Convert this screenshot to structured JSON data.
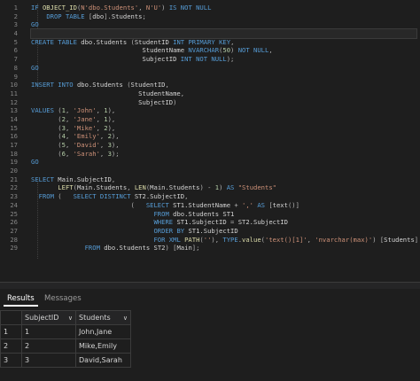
{
  "editor": {
    "line_numbers": [
      "1",
      "2",
      "3",
      "4",
      "5",
      "6",
      "7",
      "8",
      "9",
      "10",
      "11",
      "12",
      "13",
      "14",
      "15",
      "16",
      "17",
      "18",
      "19",
      "20",
      "21",
      "22",
      "23",
      "24",
      "25",
      "26",
      "27",
      "28",
      "29"
    ],
    "lines": [
      [
        [
          "kw",
          "IF "
        ],
        [
          "fn",
          "OBJECT_ID"
        ],
        [
          "op",
          "("
        ],
        [
          "str",
          "N'dbo.Students'"
        ],
        [
          "op",
          ", "
        ],
        [
          "str",
          "N'U'"
        ],
        [
          "op",
          ") "
        ],
        [
          "kw",
          "IS NOT NULL"
        ]
      ],
      [
        [
          "id",
          "    "
        ],
        [
          "kw",
          "DROP TABLE "
        ],
        [
          "op",
          "["
        ],
        [
          "id",
          "dbo"
        ],
        [
          "op",
          "]."
        ],
        [
          "id",
          "Students"
        ],
        [
          "op",
          ";"
        ]
      ],
      [
        [
          "kw",
          "GO"
        ]
      ],
      [],
      [
        [
          "kw",
          "CREATE TABLE "
        ],
        [
          "id",
          "dbo.Students "
        ],
        [
          "op",
          "("
        ],
        [
          "id",
          "StudentID "
        ],
        [
          "kw",
          "INT PRIMARY KEY"
        ],
        [
          "op",
          ","
        ]
      ],
      [
        [
          "id",
          "                             StudentName "
        ],
        [
          "kw",
          "NVARCHAR"
        ],
        [
          "op",
          "("
        ],
        [
          "num",
          "50"
        ],
        [
          "op",
          ") "
        ],
        [
          "kw",
          "NOT NULL"
        ],
        [
          "op",
          ","
        ]
      ],
      [
        [
          "id",
          "                             SubjectID "
        ],
        [
          "kw",
          "INT NOT NULL"
        ],
        [
          "op",
          ");"
        ]
      ],
      [
        [
          "kw",
          "GO"
        ]
      ],
      [],
      [
        [
          "kw",
          "INSERT INTO "
        ],
        [
          "id",
          "dbo.Students "
        ],
        [
          "op",
          "("
        ],
        [
          "id",
          "StudentID"
        ],
        [
          "op",
          ","
        ]
      ],
      [
        [
          "id",
          "                            StudentName"
        ],
        [
          "op",
          ","
        ]
      ],
      [
        [
          "id",
          "                            SubjectID"
        ],
        [
          "op",
          ")"
        ]
      ],
      [
        [
          "kw",
          "VALUES "
        ],
        [
          "op",
          "("
        ],
        [
          "num",
          "1"
        ],
        [
          "op",
          ", "
        ],
        [
          "str",
          "'John'"
        ],
        [
          "op",
          ", "
        ],
        [
          "num",
          "1"
        ],
        [
          "op",
          "),"
        ]
      ],
      [
        [
          "id",
          "       "
        ],
        [
          "op",
          "("
        ],
        [
          "num",
          "2"
        ],
        [
          "op",
          ", "
        ],
        [
          "str",
          "'Jane'"
        ],
        [
          "op",
          ", "
        ],
        [
          "num",
          "1"
        ],
        [
          "op",
          "),"
        ]
      ],
      [
        [
          "id",
          "       "
        ],
        [
          "op",
          "("
        ],
        [
          "num",
          "3"
        ],
        [
          "op",
          ", "
        ],
        [
          "str",
          "'Mike'"
        ],
        [
          "op",
          ", "
        ],
        [
          "num",
          "2"
        ],
        [
          "op",
          "),"
        ]
      ],
      [
        [
          "id",
          "       "
        ],
        [
          "op",
          "("
        ],
        [
          "num",
          "4"
        ],
        [
          "op",
          ", "
        ],
        [
          "str",
          "'Emily'"
        ],
        [
          "op",
          ", "
        ],
        [
          "num",
          "2"
        ],
        [
          "op",
          "),"
        ]
      ],
      [
        [
          "id",
          "       "
        ],
        [
          "op",
          "("
        ],
        [
          "num",
          "5"
        ],
        [
          "op",
          ", "
        ],
        [
          "str",
          "'David'"
        ],
        [
          "op",
          ", "
        ],
        [
          "num",
          "3"
        ],
        [
          "op",
          "),"
        ]
      ],
      [
        [
          "id",
          "       "
        ],
        [
          "op",
          "("
        ],
        [
          "num",
          "6"
        ],
        [
          "op",
          ", "
        ],
        [
          "str",
          "'Sarah'"
        ],
        [
          "op",
          ", "
        ],
        [
          "num",
          "3"
        ],
        [
          "op",
          ");"
        ]
      ],
      [
        [
          "kw",
          "GO"
        ]
      ],
      [],
      [
        [
          "kw",
          "SELECT "
        ],
        [
          "id",
          "Main.SubjectID"
        ],
        [
          "op",
          ","
        ]
      ],
      [
        [
          "id",
          "       "
        ],
        [
          "fn",
          "LEFT"
        ],
        [
          "op",
          "("
        ],
        [
          "id",
          "Main.Students"
        ],
        [
          "op",
          ", "
        ],
        [
          "fn",
          "LEN"
        ],
        [
          "op",
          "("
        ],
        [
          "id",
          "Main.Students"
        ],
        [
          "op",
          ") - "
        ],
        [
          "num",
          "1"
        ],
        [
          "op",
          ") "
        ],
        [
          "kw",
          "AS "
        ],
        [
          "str",
          "\"Students\""
        ]
      ],
      [
        [
          "id",
          "  "
        ],
        [
          "kw",
          "FROM "
        ],
        [
          "op",
          "(   "
        ],
        [
          "kw",
          "SELECT DISTINCT "
        ],
        [
          "id",
          "ST2.SubjectID"
        ],
        [
          "op",
          ","
        ]
      ],
      [
        [
          "id",
          "                          "
        ],
        [
          "op",
          "(   "
        ],
        [
          "kw",
          "SELECT "
        ],
        [
          "id",
          "ST1.StudentName "
        ],
        [
          "op",
          "+ "
        ],
        [
          "str",
          "','"
        ],
        [
          "id",
          " "
        ],
        [
          "kw",
          "AS "
        ],
        [
          "op",
          "["
        ],
        [
          "id",
          "text"
        ],
        [
          "op",
          "()]"
        ]
      ],
      [
        [
          "id",
          "                                "
        ],
        [
          "kw",
          "FROM "
        ],
        [
          "id",
          "dbo.Students ST1"
        ]
      ],
      [
        [
          "id",
          "                                "
        ],
        [
          "kw",
          "WHERE "
        ],
        [
          "id",
          "ST1.SubjectID "
        ],
        [
          "op",
          "= "
        ],
        [
          "id",
          "ST2.SubjectID"
        ]
      ],
      [
        [
          "id",
          "                                "
        ],
        [
          "kw",
          "ORDER BY "
        ],
        [
          "id",
          "ST1.SubjectID"
        ]
      ],
      [
        [
          "id",
          "                                "
        ],
        [
          "kw",
          "FOR XML "
        ],
        [
          "fn",
          "PATH"
        ],
        [
          "op",
          "("
        ],
        [
          "str",
          "''"
        ],
        [
          "op",
          "), "
        ],
        [
          "kw",
          "TYPE"
        ],
        [
          "op",
          "."
        ],
        [
          "fn",
          "value"
        ],
        [
          "op",
          "("
        ],
        [
          "str",
          "'text()[1]'"
        ],
        [
          "op",
          ", "
        ],
        [
          "str",
          "'nvarchar(max)'"
        ],
        [
          "op",
          ") ["
        ],
        [
          "id",
          "Students"
        ],
        [
          "op",
          "]"
        ]
      ],
      [
        [
          "id",
          "              "
        ],
        [
          "kw",
          "FROM "
        ],
        [
          "id",
          "dbo.Students ST2"
        ],
        [
          "op",
          ") ["
        ],
        [
          "id",
          "Main"
        ],
        [
          "op",
          "];"
        ]
      ]
    ]
  },
  "results_pane": {
    "tabs": [
      {
        "label": "Results"
      },
      {
        "label": "Messages"
      }
    ],
    "columns": [
      "SubjectID",
      "Students"
    ],
    "rows": [
      {
        "num": "1",
        "subject_id": "1",
        "students": "John,Jane"
      },
      {
        "num": "2",
        "subject_id": "2",
        "students": "Mike,Emily"
      },
      {
        "num": "3",
        "subject_id": "3",
        "students": "David,Sarah"
      }
    ]
  },
  "colors": {
    "keyword": "#569cd6",
    "string": "#ce9178",
    "number": "#b5cea8",
    "function": "#dcdcaa",
    "background": "#1e1e1e"
  }
}
